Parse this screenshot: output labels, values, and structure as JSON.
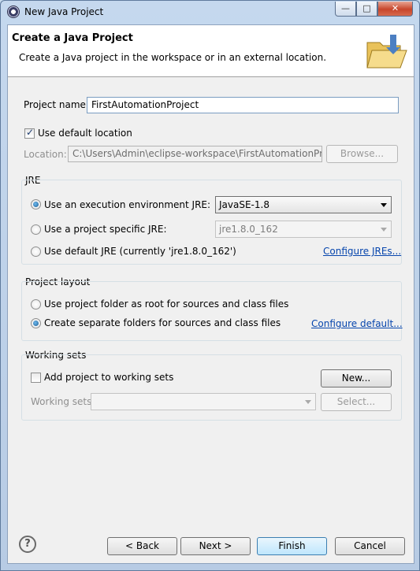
{
  "window": {
    "title": "New Java Project",
    "controls": {
      "minimize": "—",
      "maximize": "□",
      "close": "✕"
    }
  },
  "banner": {
    "title": "Create a Java Project",
    "description": "Create a Java project in the workspace or in an external location."
  },
  "project": {
    "name_label": "Project name:",
    "name_value": "FirstAutomationProject",
    "use_default_location_label": "Use default location",
    "use_default_location_checked": true,
    "location_label": "Location:",
    "location_value": "C:\\Users\\Admin\\eclipse-workspace\\FirstAutomationProject",
    "browse_label": "Browse..."
  },
  "jre": {
    "group_title": "JRE",
    "options": [
      {
        "label": "Use an execution environment JRE:",
        "selected": true
      },
      {
        "label": "Use a project specific JRE:",
        "selected": false
      },
      {
        "label": "Use default JRE (currently 'jre1.8.0_162')",
        "selected": false
      }
    ],
    "execution_env_value": "JavaSE-1.8",
    "project_specific_value": "jre1.8.0_162",
    "configure_link": "Configure JREs..."
  },
  "layout": {
    "group_title": "Project layout",
    "options": [
      {
        "label": "Use project folder as root for sources and class files",
        "selected": false
      },
      {
        "label": "Create separate folders for sources and class files",
        "selected": true
      }
    ],
    "configure_link": "Configure default..."
  },
  "working_sets": {
    "group_title": "Working sets",
    "add_label": "Add project to working sets",
    "add_checked": false,
    "new_button": "New...",
    "sets_label": "Working sets:",
    "sets_value": "",
    "select_button": "Select..."
  },
  "footer": {
    "help": "?",
    "back": "< Back",
    "next": "Next >",
    "finish": "Finish",
    "cancel": "Cancel"
  }
}
